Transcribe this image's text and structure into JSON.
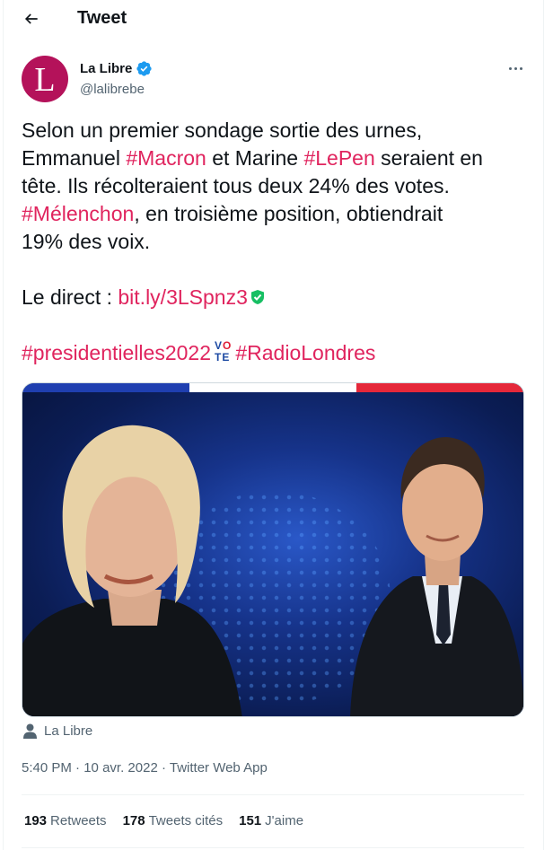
{
  "header": {
    "title": "Tweet"
  },
  "author": {
    "display_name": "La Libre",
    "handle": "@lalibrebe",
    "avatar_letter": "L",
    "avatar_color": "#b4125a",
    "verified": true
  },
  "tweet": {
    "line1": "Selon un premier sondage sortie des urnes,",
    "line2_pre": "Emmanuel ",
    "tag_macron": "#Macron",
    "line2_mid": " et Marine ",
    "tag_lepen": "#LePen",
    "line2_post": " seraient en",
    "line3": "tête. Ils récolteraient tous deux 24% des votes.",
    "tag_melenchon": "#Mélenchon",
    "line4_post": ", en troisième position, obtiendrait",
    "line5": "19% des voix.",
    "direct_label": "Le direct : ",
    "direct_link": "bit.ly/3LSpnz3",
    "tag_presidentielles": "#presidentielles2022",
    "tag_radiolondres": "#RadioLondres",
    "vote_emoji": {
      "top": "V",
      "top2": "O",
      "bottom": "TE"
    }
  },
  "media": {
    "credit": "La Libre",
    "flag_colors": [
      "#1f3fb0",
      "#ffffff",
      "#e5283a"
    ]
  },
  "meta": {
    "time": "5:40 PM",
    "date": "10 avr. 2022",
    "client": "Twitter Web App"
  },
  "stats": {
    "retweets_count": "193",
    "retweets_label": "Retweets",
    "quotes_count": "178",
    "quotes_label": "Tweets cités",
    "likes_count": "151",
    "likes_label": "J'aime"
  },
  "colors": {
    "link": "#e0245e",
    "secondary_text": "#536471",
    "verified_badge": "#1d9bf0"
  },
  "icons": [
    "back-arrow-icon",
    "verified-badge-icon",
    "more-options-icon",
    "shield-check-icon",
    "person-icon"
  ]
}
